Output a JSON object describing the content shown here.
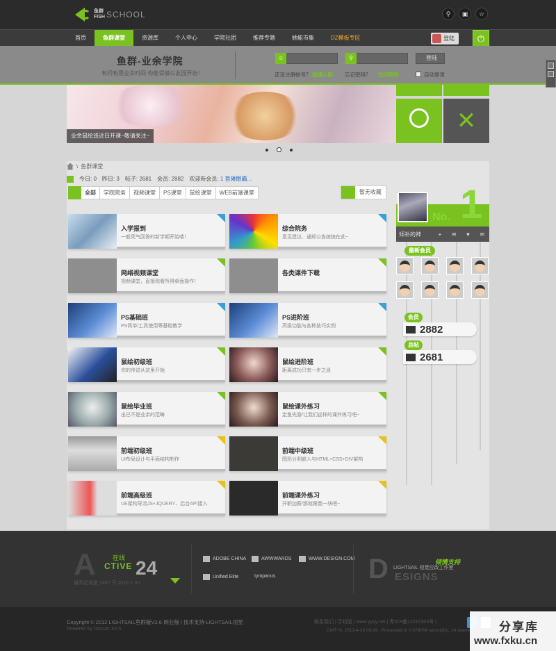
{
  "colors": {
    "accent": "#7ac21f",
    "dark": "#2b2b2b",
    "highlight": "#f5a623",
    "link": "#2a6dbf"
  },
  "logo": {
    "line1": "鱼群",
    "line2": "FISH",
    "school": "SCHOOL"
  },
  "top_icons": [
    "search-icon",
    "monitor-icon",
    "star-icon"
  ],
  "nav": {
    "items": [
      "首页",
      "鱼群课堂",
      "资源库",
      "个人中心",
      "学院社团",
      "推荐专题",
      "她能市集",
      "DZ模板专区"
    ],
    "login_label": "登陆"
  },
  "header": {
    "title": "鱼群-业余学院",
    "subtitle": "有问有用业余时间·你能得做以此园开始！",
    "login_button": "登陆",
    "question1": "还没注册帐号？",
    "register_link": "加请入群",
    "question2": "忘记密码？",
    "forgot_link": "找回密码",
    "remember": "自动登录"
  },
  "banner": {
    "caption": "业余鼠绘班近日开课~敬请关注~"
  },
  "breadcrumb": {
    "label": "鱼群课堂"
  },
  "stats": {
    "today_label": "今日:",
    "today": "0",
    "yesterday_label": "昨日:",
    "yesterday": "3",
    "posts_label": "帖子:",
    "posts": "2681",
    "members_label": "会员:",
    "members": "2882",
    "welcome_label": "欢迎新会员:",
    "new_member": "1 首傩眼霸..."
  },
  "tabs": [
    "全部",
    "学院院务",
    "视频课堂",
    "PS课堂",
    "鼠绘课堂",
    "WEB前端课堂"
  ],
  "favorite_label": "暂无收藏",
  "forums": [
    {
      "name": "入学报到",
      "desc": "一般凭气回答的新学期开始喽！"
    },
    {
      "name": "综合院务",
      "desc": "意见建议、通知公告统统在此~"
    },
    {
      "name": "网络视频课堂",
      "desc": "视频课堂，直接观看所得桌面操作！"
    },
    {
      "name": "各类课件下载",
      "desc": ""
    },
    {
      "name": "PS基础班",
      "desc": "PS简单/工具使用等基础教学"
    },
    {
      "name": "PS进阶班",
      "desc": "高级功能与各种技巧实例"
    },
    {
      "name": "鼠绘初级班",
      "desc": "你的传说从这里开始"
    },
    {
      "name": "鼠绘进阶班",
      "desc": "距离成功只有一步之遥"
    },
    {
      "name": "鼠绘毕业班",
      "desc": "出已不是业余的范畴"
    },
    {
      "name": "鼠绘课外练习",
      "desc": "定鱼先游/让我们这样的课外练习吧~"
    },
    {
      "name": "前端初级班",
      "desc": "UI布局设计与平面结构制作"
    },
    {
      "name": "前端中级班",
      "desc": "图形分割嵌入与HTML+CSS+DIV架构"
    },
    {
      "name": "前端高级班",
      "desc": "UE架构导流JS+JQUERY、后台API接入"
    },
    {
      "name": "前端课外练习",
      "desc": "开职加薪/那就跟我一块吧~"
    }
  ],
  "sidebar": {
    "rank_prefix": "No.",
    "rank": "1",
    "member_name": "倾补的神",
    "new_members_label": "最新会员",
    "total_label": "会员",
    "total": "2882",
    "posts_label": "总帖",
    "posts": "2681"
  },
  "footer": {
    "active_letter": "A",
    "active_word": "CTIVE",
    "online_label": "在线",
    "online_count": "24",
    "online_sub": "最高记录是 1467 于 2012-1-30",
    "partners": [
      "ADOBE CHINA",
      "AWWWARDS",
      "WWW.DESIGN.COM",
      "Unified Elite",
      "tympanus"
    ],
    "designs_letter": "D",
    "designs_small": "LIGHTSAIL 视觉应改工作室",
    "designs_big": "ESIGNS",
    "designs_support": "倾情支持"
  },
  "copyright": {
    "line1": "Copyright © 2012 LIGHTSAIL鱼群版V2.6-网业版 | 技术支持-LIGHTSAIL视觉",
    "line2": "Powered by Discuz! X2.5",
    "links": "联系我们 | 手机版 | www.yyqy.net | 粤ICP备12010304号 |",
    "gmt": "GMT+8, 2013-4-26 09:04 , Processed in 0.074064 second(s), 14 queries ."
  },
  "watermark": {
    "cn": "分享库",
    "url": "www.fxku.cn"
  }
}
